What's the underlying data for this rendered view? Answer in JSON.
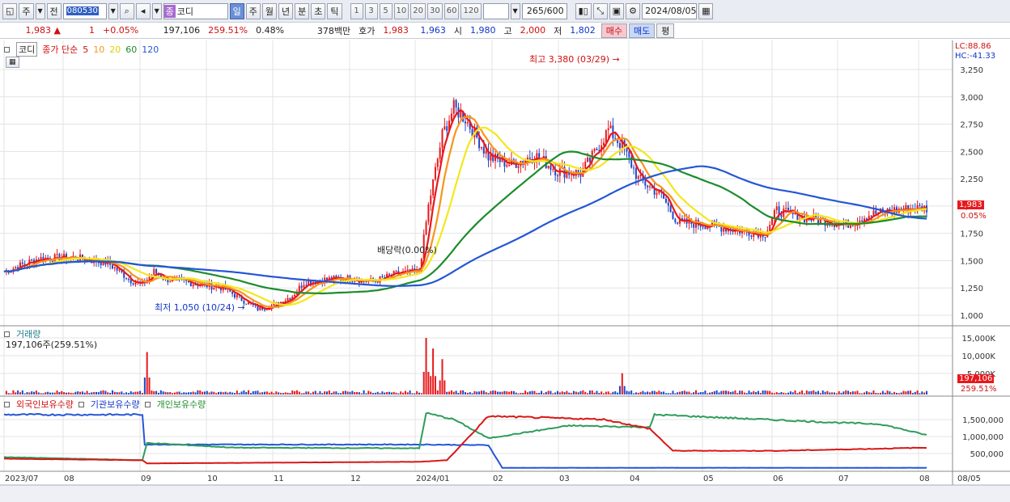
{
  "toolbar": {
    "period_1": "주",
    "period_2": "전",
    "code": "080530",
    "name_prefix": "종",
    "name": "코디",
    "periods": [
      "일",
      "주",
      "월",
      "년",
      "분",
      "초",
      "틱"
    ],
    "minute_buttons": [
      "1",
      "3",
      "5",
      "10",
      "20",
      "30",
      "60",
      "120"
    ],
    "count": "265",
    "count_total": "/600",
    "date": "2024/08/05"
  },
  "quote": {
    "price": "1,983",
    "change_arrow": "▲",
    "change": "1",
    "change_pct": "+0.05%",
    "volume": "197,106",
    "volume_ratio": "259.51%",
    "turnover": "0.48%",
    "amount": "378백만",
    "bid_label": "호가",
    "bid": "1,983",
    "ask": "1,963",
    "open_label": "시",
    "open": "1,980",
    "high_label": "고",
    "high": "2,000",
    "low_label": "저",
    "low": "1,802",
    "buy": "매수",
    "sell": "매도",
    "eval": "평"
  },
  "legend": {
    "name": "코디",
    "ma_title": "종가 단순",
    "ma": [
      "5",
      "10",
      "20",
      "60",
      "120"
    ],
    "lc": "LC:88.86",
    "hc": "HC:-41.33",
    "volume_title": "거래량",
    "volume_value": "197,106주(259.51%)",
    "holdings": [
      "외국인보유수량",
      "기관보유수량",
      "개인보유수량"
    ]
  },
  "annotations": {
    "high": "최고 3,380 (03/29)",
    "low": "최저 1,050 (10/24)",
    "dividend": "배당락(0.00%)"
  },
  "tags": {
    "price": "1,983",
    "pct": "0.05%",
    "vol": "197,106",
    "vol_pct": "259.51%"
  },
  "colors": {
    "ma5": "#e8181c",
    "ma10": "#f7941d",
    "ma20": "#f2e81c",
    "ma60": "#1c8c2c",
    "ma120": "#2456d6",
    "up": "#e8181c",
    "down": "#1f47c8"
  },
  "chart_data": {
    "type": "candlestick",
    "x_labels": [
      "2023/07",
      "08",
      "09",
      "10",
      "11",
      "12",
      "2024/01",
      "02",
      "03",
      "04",
      "05",
      "06",
      "07",
      "08",
      "08/05"
    ],
    "price_axis": [
      "3,250",
      "3,000",
      "2,750",
      "2,500",
      "2,250",
      "2,000",
      "1,750",
      "1,500",
      "1,250",
      "1,000"
    ],
    "volume_axis": [
      "15,000K",
      "10,000K",
      "5,000K"
    ],
    "holding_axis": [
      "1,500,000",
      "1,000,000",
      "500,000"
    ],
    "price_series": [
      [
        0,
        1400
      ],
      [
        15,
        1520
      ],
      [
        30,
        1530
      ],
      [
        45,
        1480
      ],
      [
        55,
        1320
      ],
      [
        60,
        1280
      ],
      [
        65,
        1400
      ],
      [
        70,
        1330
      ],
      [
        80,
        1300
      ],
      [
        95,
        1250
      ],
      [
        105,
        1120
      ],
      [
        110,
        1060
      ],
      [
        118,
        1100
      ],
      [
        125,
        1180
      ],
      [
        130,
        1300
      ],
      [
        140,
        1330
      ],
      [
        150,
        1340
      ],
      [
        160,
        1310
      ],
      [
        170,
        1380
      ],
      [
        180,
        1400
      ],
      [
        184,
        2000
      ],
      [
        190,
        2650
      ],
      [
        195,
        2900
      ],
      [
        200,
        2800
      ],
      [
        210,
        2450
      ],
      [
        220,
        2380
      ],
      [
        230,
        2470
      ],
      [
        240,
        2320
      ],
      [
        250,
        2300
      ],
      [
        255,
        2450
      ],
      [
        262,
        2700
      ],
      [
        268,
        2550
      ],
      [
        275,
        2250
      ],
      [
        285,
        2100
      ],
      [
        292,
        1850
      ],
      [
        305,
        1830
      ],
      [
        320,
        1770
      ],
      [
        330,
        1750
      ],
      [
        335,
        1960
      ],
      [
        345,
        1900
      ],
      [
        355,
        1870
      ],
      [
        365,
        1830
      ],
      [
        375,
        1920
      ],
      [
        385,
        1960
      ],
      [
        395,
        1980
      ],
      [
        400,
        1983
      ]
    ],
    "volume_spikes_k": [
      [
        62,
        12000
      ],
      [
        183,
        16000
      ],
      [
        186,
        13000
      ],
      [
        190,
        10000
      ],
      [
        268,
        6000
      ]
    ]
  }
}
